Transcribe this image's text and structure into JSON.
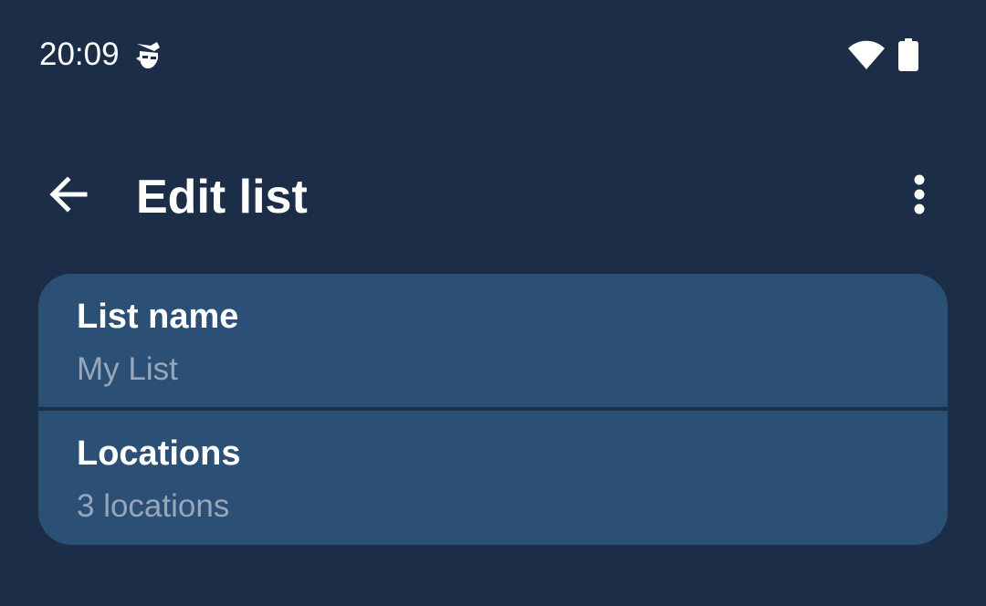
{
  "status_bar": {
    "time": "20:09",
    "icons": [
      "incognito-icon",
      "wifi-icon",
      "battery-icon"
    ]
  },
  "app_bar": {
    "back_icon": "arrow-back-icon",
    "title": "Edit list",
    "overflow_icon": "more-vert-icon"
  },
  "settings": {
    "items": [
      {
        "title": "List name",
        "subtitle": "My List"
      },
      {
        "title": "Locations",
        "subtitle": "3 locations"
      }
    ]
  },
  "colors": {
    "background": "#1b2d47",
    "card": "#2b4f75",
    "primary_text": "#ffffff",
    "secondary_text": "#97a7bb"
  }
}
